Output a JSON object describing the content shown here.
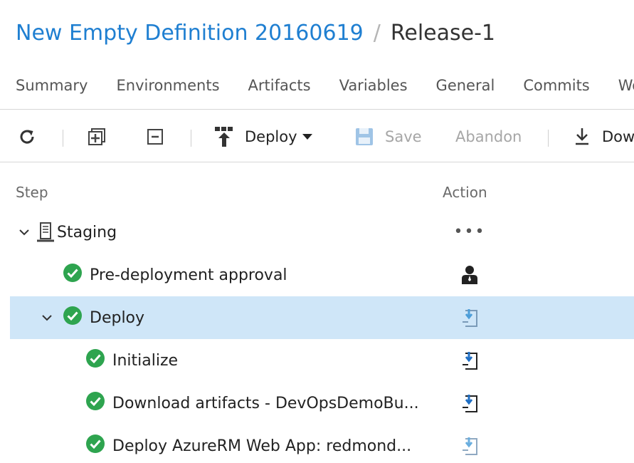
{
  "breadcrumb": {
    "definition": "New Empty Definition 20160619",
    "separator": "/",
    "release": "Release-1"
  },
  "tabs": [
    "Summary",
    "Environments",
    "Artifacts",
    "Variables",
    "General",
    "Commits",
    "Wo"
  ],
  "toolbar": {
    "refresh_icon": "refresh-icon",
    "expand_icon": "expand-all-icon",
    "collapse_icon": "collapse-all-icon",
    "deploy_label": "Deploy",
    "save_label": "Save",
    "abandon_label": "Abandon",
    "download_label": "Dow"
  },
  "grid": {
    "columns": {
      "step": "Step",
      "action": "Action"
    },
    "rows": [
      {
        "label": "Staging",
        "level": 0,
        "expanded": true,
        "icon": "environment-icon",
        "action_icon": "more-actions-icon",
        "status": "none"
      },
      {
        "label": "Pre-deployment approval",
        "level": 1,
        "icon": "success-check-icon",
        "action_icon": "approval-user-icon",
        "status": "succeeded"
      },
      {
        "label": "Deploy",
        "level": 1,
        "expanded": true,
        "icon": "success-check-icon",
        "action_icon": "download-log-icon",
        "status": "succeeded",
        "selected": true
      },
      {
        "label": "Initialize",
        "level": 2,
        "icon": "success-check-icon",
        "action_icon": "download-log-icon",
        "status": "succeeded"
      },
      {
        "label": "Download artifacts - DevOpsDemoBu...",
        "level": 2,
        "icon": "success-check-icon",
        "action_icon": "download-log-icon",
        "status": "succeeded"
      },
      {
        "label": "Deploy AzureRM Web App: redmond...",
        "level": 2,
        "icon": "success-check-icon",
        "action_icon": "download-log-icon",
        "status": "succeeded"
      }
    ]
  },
  "colors": {
    "link": "#1f7fd1",
    "success": "#2ea44f",
    "selected_row": "#cfe6f8",
    "disabled_text": "#a6a6a6"
  }
}
